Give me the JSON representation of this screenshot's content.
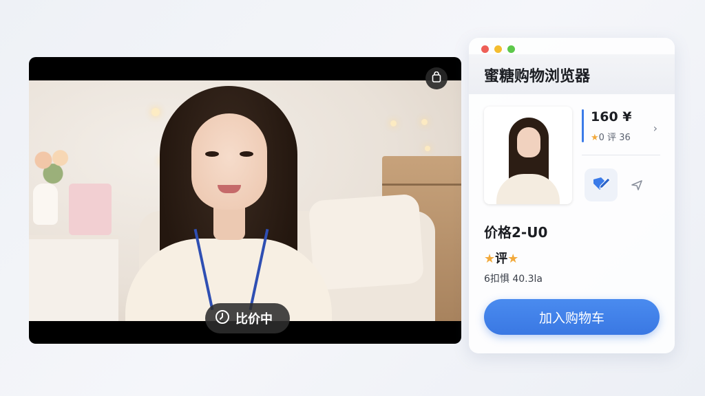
{
  "video": {
    "overlay_label": "比价中",
    "icons": {
      "lock": "shopping-bag-icon",
      "timer": "clock-icon"
    }
  },
  "browser": {
    "title": "蜜糖购物浏览器",
    "traffic_lights": {
      "close": "#ee5f57",
      "minimize": "#f4bd2f",
      "maximize": "#5dc84a"
    },
    "product_card": {
      "price": "160 ¥",
      "rating_star": "★",
      "rating_text": "0 评 36",
      "chevron": "›"
    },
    "actions": [
      {
        "icon": "tag-edit-icon"
      },
      {
        "icon": "send-icon"
      }
    ],
    "info": {
      "price_line": "价格2-U0",
      "rating_prefix_star": "★",
      "rating_label": "评",
      "rating_suffix_star": "★",
      "sales_line": "6扣惧 40.3la"
    },
    "cart_button": "加入购物车",
    "colors": {
      "accent": "#3b7be8",
      "star": "#f2a93b"
    }
  }
}
